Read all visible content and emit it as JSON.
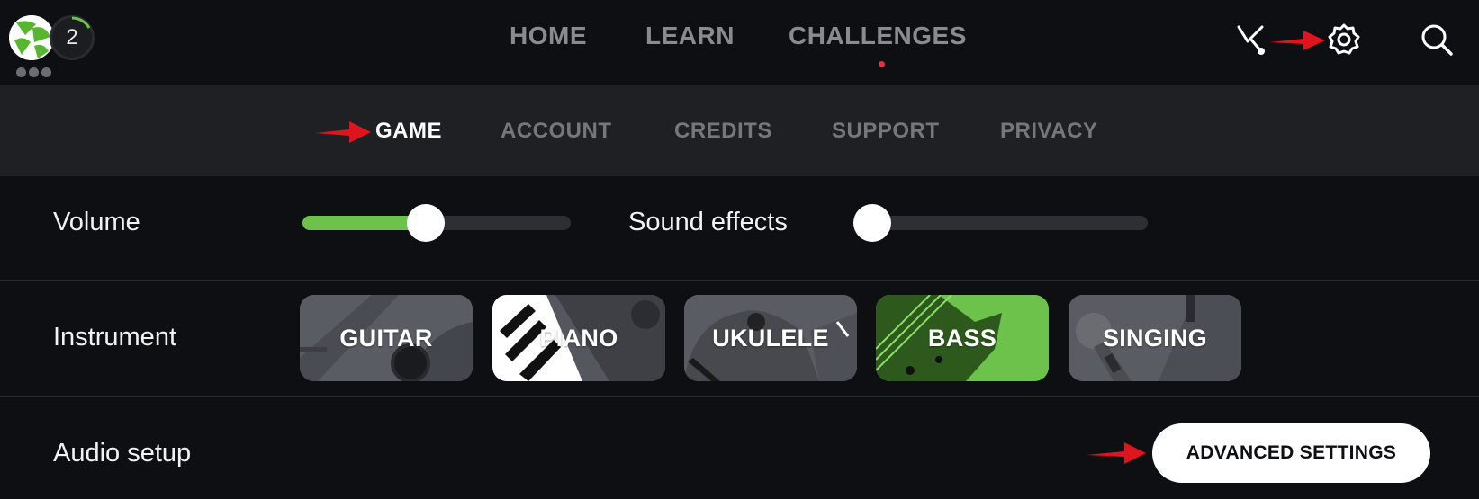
{
  "header": {
    "level": "2",
    "nav": [
      {
        "label": "HOME"
      },
      {
        "label": "LEARN"
      },
      {
        "label": "CHALLENGES"
      }
    ]
  },
  "settings_tabs": [
    {
      "label": "GAME",
      "active": true
    },
    {
      "label": "ACCOUNT",
      "active": false
    },
    {
      "label": "CREDITS",
      "active": false
    },
    {
      "label": "SUPPORT",
      "active": false
    },
    {
      "label": "PRIVACY",
      "active": false
    }
  ],
  "game": {
    "volume": {
      "label": "Volume",
      "level": 0.46
    },
    "sound_effects": {
      "label": "Sound effects",
      "level": 0.0
    },
    "instrument": {
      "label": "Instrument",
      "options": [
        {
          "label": "GUITAR",
          "selected": false
        },
        {
          "label": "PIANO",
          "selected": false
        },
        {
          "label": "UKULELE",
          "selected": false
        },
        {
          "label": "BASS",
          "selected": true
        },
        {
          "label": "SINGING",
          "selected": false
        }
      ]
    },
    "audio_setup": {
      "label": "Audio setup",
      "button_label": "ADVANCED SETTINGS"
    }
  },
  "colors": {
    "accent_green": "#6cc24a",
    "active_indicator": "#e0343a",
    "annotation_arrow": "#e0141c",
    "background": "#0e0f12",
    "tab_bar": "#1f2024"
  },
  "icons": [
    "tuner-fork-icon",
    "gear-icon",
    "search-icon"
  ]
}
